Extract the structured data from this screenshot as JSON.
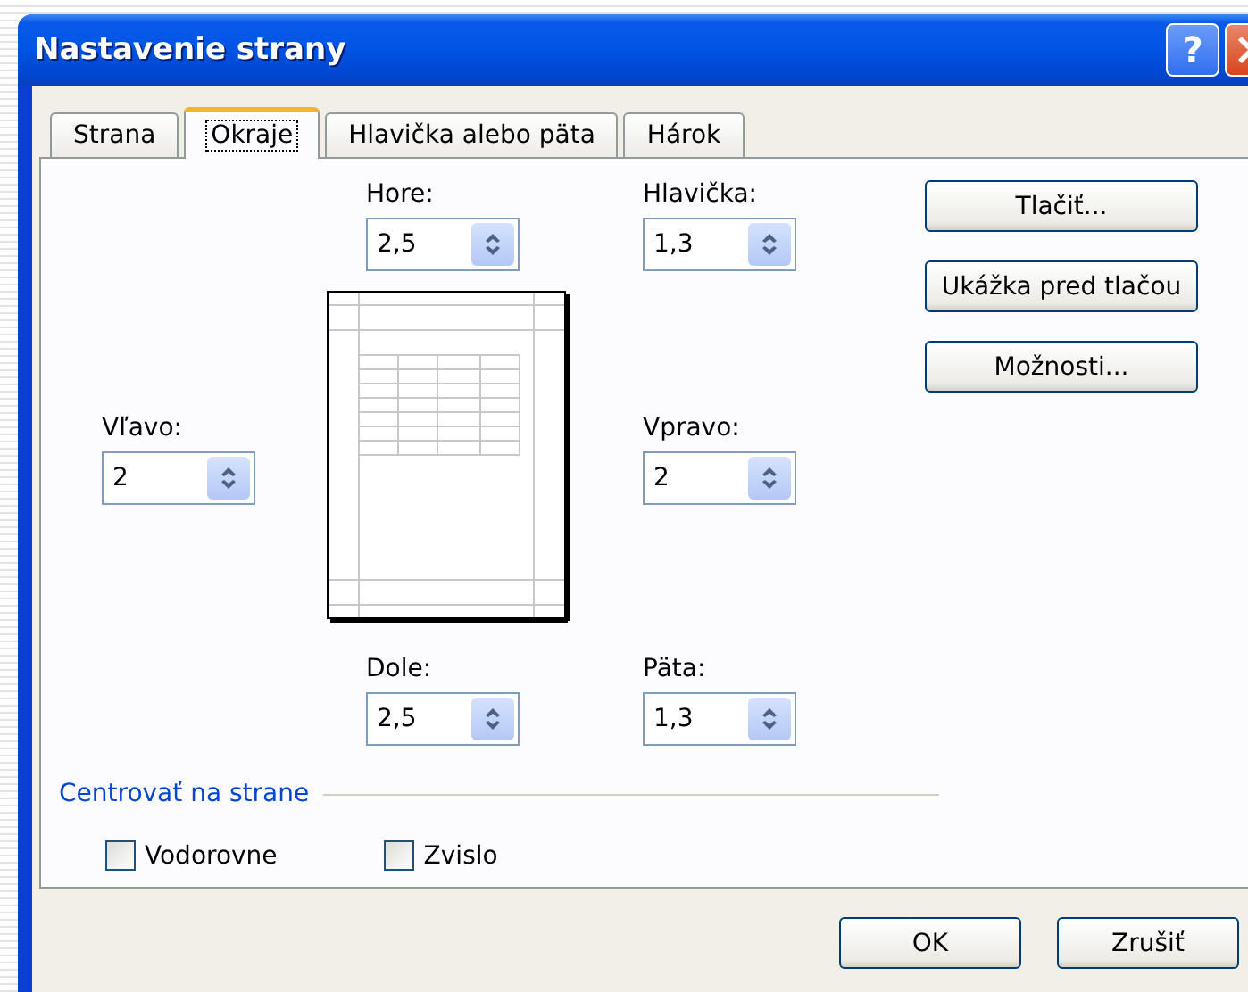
{
  "window": {
    "title": "Nastavenie strany",
    "help_button": "?"
  },
  "tabs": [
    {
      "label": "Strana",
      "selected": false
    },
    {
      "label": "Okraje",
      "selected": true
    },
    {
      "label": "Hlavička alebo päta",
      "selected": false
    },
    {
      "label": "Hárok",
      "selected": false
    }
  ],
  "margins": {
    "top": {
      "label": "Hore:",
      "value": "2,5"
    },
    "header": {
      "label": "Hlavička:",
      "value": "1,3"
    },
    "left": {
      "label": "Vľavo:",
      "value": "2"
    },
    "right": {
      "label": "Vpravo:",
      "value": "2"
    },
    "bottom": {
      "label": "Dole:",
      "value": "2,5"
    },
    "footer": {
      "label": "Päta:",
      "value": "1,3"
    }
  },
  "side_buttons": [
    {
      "label": "Tlačiť..."
    },
    {
      "label": "Ukážka pred tlačou"
    },
    {
      "label": "Možnosti..."
    }
  ],
  "center_on_page": {
    "title": "Centrovať na strane",
    "options": [
      {
        "label": "Vodorovne",
        "checked": false
      },
      {
        "label": "Zvislo",
        "checked": false
      }
    ]
  },
  "buttons": [
    "OK",
    "Zrušiť"
  ]
}
